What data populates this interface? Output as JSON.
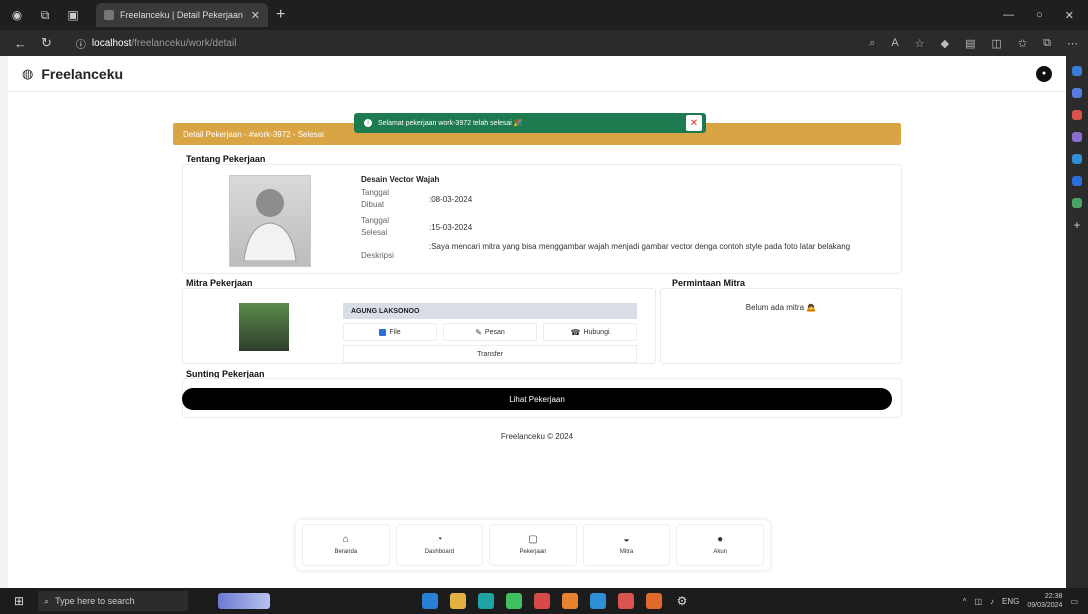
{
  "browser": {
    "tab_title": "Freelanceku | Detail Pekerjaan",
    "url_host": "localhost",
    "url_path": "/freelanceku/work/detail"
  },
  "app": {
    "brand": "Freelanceku",
    "avatar_glyph": "●"
  },
  "toast": {
    "message": "Selamat pekerjaan work-3972 telah selesai 🎉",
    "close_glyph": "✕"
  },
  "banner": {
    "text": "Detail Pekerjaan - #work-3972 - Selesai"
  },
  "about": {
    "section_title": "Tentang Pekerjaan",
    "job_title": "Desain Vector Wajah",
    "created_label": "Tanggal Dibuat",
    "created_value": ":08-03-2024",
    "finished_label": "Tanggal Selesai",
    "finished_value": ":15-03-2024",
    "desc_label": "Deskripsi",
    "desc_value": ":Saya mencari mitra yang bisa menggambar wajah menjadi gambar vector denga contoh style pada foto latar belakang"
  },
  "partner": {
    "section_title": "Mitra Pekerjaan",
    "name": "AGUNG LAKSONOO",
    "file_label": "File",
    "message_label": "Pesan",
    "contact_label": "Hubungi",
    "transfer_label": "Transfer"
  },
  "requests": {
    "section_title": "Permintaan Mitra",
    "empty_text": "Belum ada mitra 🙇"
  },
  "edit": {
    "section_title": "Sunting Pekerjaan",
    "view_button": "Lihat Pekerjaan"
  },
  "footer": "Freelanceku © 2024",
  "bottom_nav": [
    {
      "label": "Beranda",
      "glyph": "⌂"
    },
    {
      "label": "Dashboard",
      "glyph": "◔"
    },
    {
      "label": "Pekerjaan",
      "glyph": "▢"
    },
    {
      "label": "Mitra",
      "glyph": "◒"
    },
    {
      "label": "Akun",
      "glyph": "●"
    }
  ],
  "taskbar": {
    "search_placeholder": "Type here to search",
    "lang": "ENG",
    "time": "22:38",
    "date": "09/03/2024"
  },
  "colors": {
    "toast_bg": "#1e7a4f",
    "banner_bg": "#d9a444",
    "primary_button": "#000000"
  }
}
